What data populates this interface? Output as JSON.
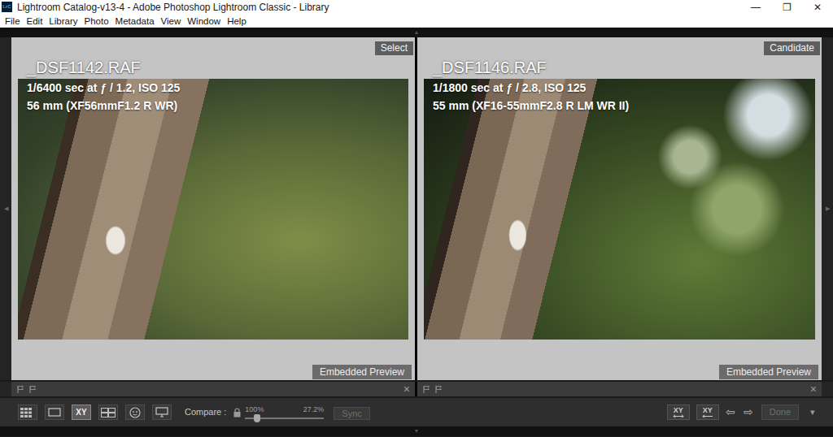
{
  "window": {
    "app_icon": "LrC",
    "title": "Lightroom Catalog-v13-4 - Adobe Photoshop Lightroom Classic - Library",
    "controls": [
      "—",
      "❐",
      "✕"
    ]
  },
  "menu": [
    "File",
    "Edit",
    "Library",
    "Photo",
    "Metadata",
    "View",
    "Window",
    "Help"
  ],
  "edge_arrows": {
    "top": "▲",
    "left": "◀",
    "right": "▶",
    "bottom": "▼"
  },
  "panels": [
    {
      "tag": "Select",
      "file": "_DSF1142.RAF",
      "exposure": "1/6400 sec at ƒ / 1.2, ISO 125",
      "lens": "56 mm (XF56mmF1.2 R WR)",
      "preview": "Embedded Preview",
      "close": "×"
    },
    {
      "tag": "Candidate",
      "file": "_DSF1146.RAF",
      "exposure": "1/1800 sec at ƒ / 2.8, ISO 125",
      "lens": "55 mm (XF16-55mmF2.8 R LM WR II)",
      "preview": "Embedded Preview",
      "close": "×"
    }
  ],
  "toolbar": {
    "views": [
      {
        "kind": "grid",
        "label": "",
        "selected": false
      },
      {
        "kind": "loupe",
        "label": "",
        "selected": false
      },
      {
        "kind": "compare",
        "label": "XY",
        "selected": true
      },
      {
        "kind": "survey",
        "label": "",
        "selected": false
      },
      {
        "kind": "people",
        "label": "",
        "selected": false
      },
      {
        "kind": "secondary",
        "label": "",
        "selected": false
      }
    ],
    "compare_label": "Compare :",
    "zoom_left": "100%",
    "zoom_right": "27.2%",
    "zoom_level": 0.15,
    "sync": {
      "label": "Sync",
      "disabled": true
    },
    "swap_buttons": [
      {
        "label": "XY",
        "kind": "swap"
      },
      {
        "label": "XY",
        "kind": "promote"
      }
    ],
    "nav": [
      "⇦",
      "⇨"
    ],
    "done": {
      "label": "Done",
      "disabled": true
    },
    "menu_arrow": "▾"
  }
}
